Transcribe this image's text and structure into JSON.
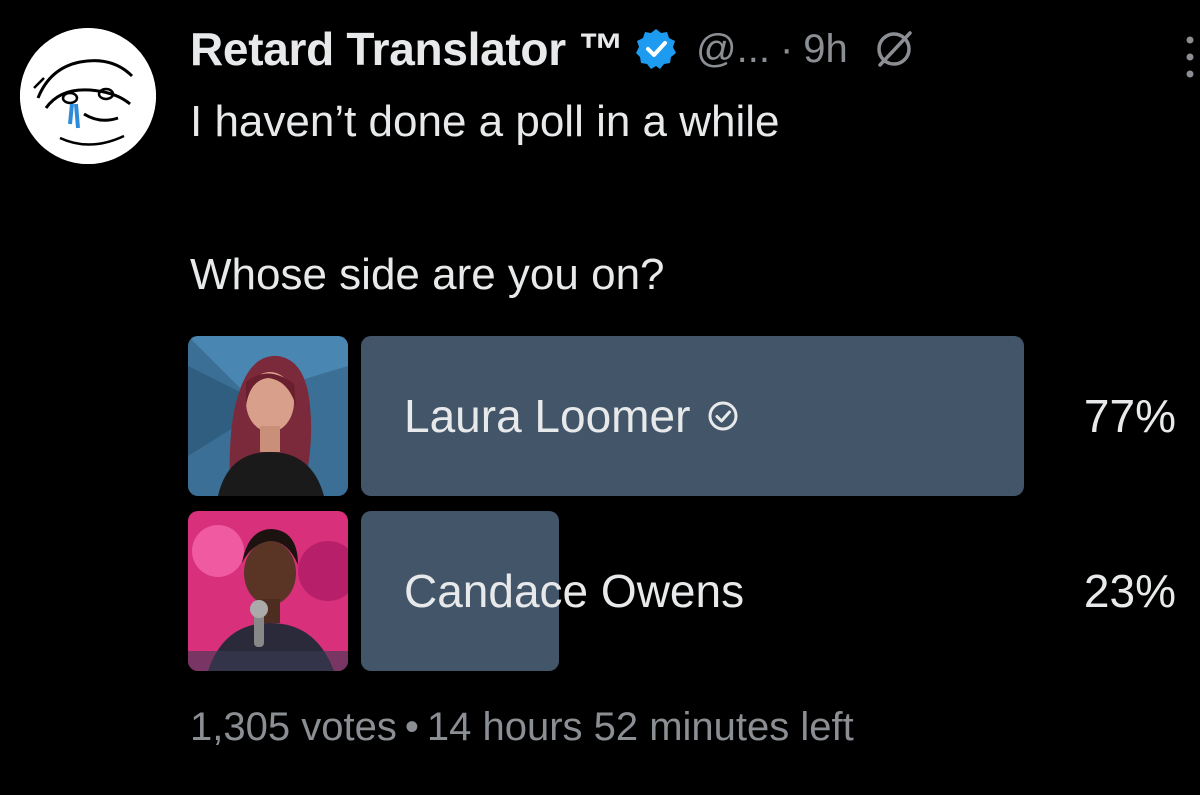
{
  "tweet": {
    "author_name": "Retard Translator ™",
    "handle": "@...",
    "separator": "·",
    "time": "9h",
    "text": "I haven’t done a poll in a while",
    "question": "Whose side are you on?",
    "icons": {
      "verified": "verified-badge-icon",
      "grok": "grok-icon",
      "more": "more-vertical-icon"
    }
  },
  "poll": {
    "options": [
      {
        "label": "Laura Loomer",
        "percent": 77,
        "percent_label": "77%",
        "selected": true
      },
      {
        "label": "Candace Owens",
        "percent": 23,
        "percent_label": "23%",
        "selected": false
      }
    ],
    "votes": "1,305 votes",
    "dot": "•",
    "time_left": "14 hours 52 minutes left"
  },
  "colors": {
    "background": "#000000",
    "text": "#e7e9ea",
    "muted": "#8b8f94",
    "bar": "#435669",
    "verified": "#1d9bf0"
  }
}
